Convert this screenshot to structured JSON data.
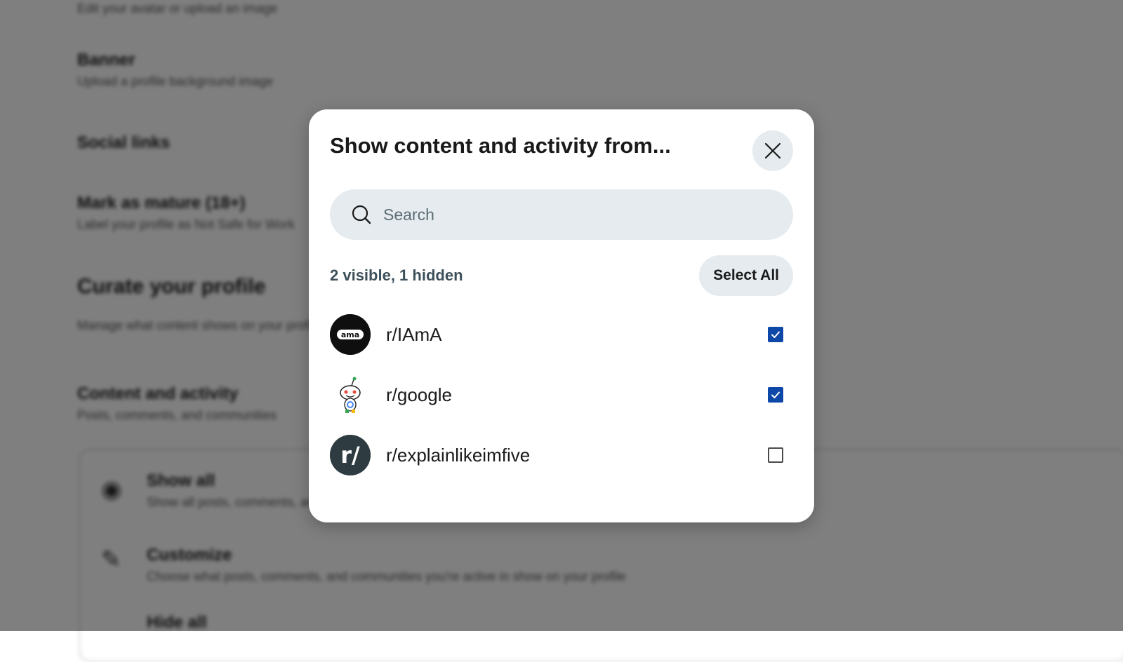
{
  "background": {
    "sections": [
      {
        "title": "",
        "sub": "Edit your avatar or upload an image"
      },
      {
        "title": "Banner",
        "sub": "Upload a profile background image"
      },
      {
        "title": "Social links",
        "sub": ""
      },
      {
        "title": "Mark as mature (18+)",
        "sub": "Label your profile as Not Safe for Work"
      }
    ],
    "curate_heading": "Curate your profile",
    "curate_sub": "Manage what content shows on your profile",
    "content_title": "Content and activity",
    "content_sub": "Posts, comments, and communities",
    "card_rows": [
      {
        "title": "Show all",
        "sub": "Show all posts, comments, and communities"
      },
      {
        "title": "Customize",
        "sub": "Choose what posts, comments, and communities you're active in show on your profile"
      },
      {
        "title": "Hide all",
        "sub": ""
      }
    ]
  },
  "modal": {
    "title": "Show content and activity from...",
    "close_icon": "close-icon",
    "search": {
      "placeholder": "Search",
      "value": "",
      "icon": "search-icon"
    },
    "status_text": "2 visible, 1 hidden",
    "select_all_label": "Select All",
    "communities": [
      {
        "name": "r/IAmA",
        "avatar": "ama-avatar",
        "checked": true
      },
      {
        "name": "r/google",
        "avatar": "snoo-avatar",
        "checked": true
      },
      {
        "name": "r/explainlikeimfive",
        "avatar": "r-slash-avatar",
        "checked": false
      }
    ]
  },
  "colors": {
    "accent_checkbox": "#0d48a8",
    "button_bg": "#e5ebee",
    "status_text": "#3d5059",
    "overlay": "#7f7f7f"
  }
}
